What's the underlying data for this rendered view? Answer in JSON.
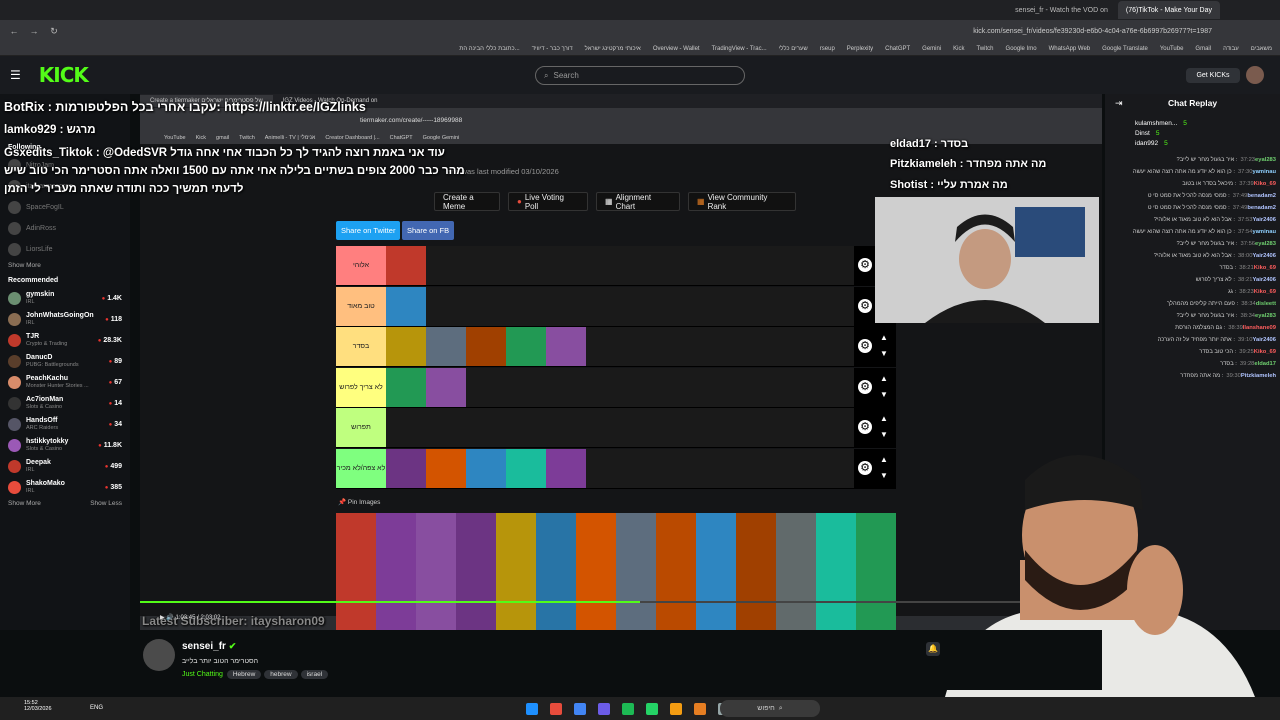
{
  "browser": {
    "tabs": [
      "(76)TikTok - Make Your Day",
      "sensei_fr - Watch the VOD on"
    ],
    "url": "kick.com/sensei_fr/videos/fe39230d-e6b0-4c04-a76e-6b6997b26977?t=1987",
    "bookmarks": [
      "משאבים",
      "עבודה",
      "Gmail",
      "YouTube",
      "Google Translate",
      "WhatsApp Web",
      "Google Imo",
      "Twitch",
      "Kick",
      "Gemini",
      "ChatGPT",
      "Perplexity",
      "rseup",
      "שערים כללי",
      "TradingView - Trac...",
      "Overview - Wallet",
      "איכותי מרקטינג ישראל",
      "דורך כבר - דיוויד",
      "כתובת כללי הבינה הת..."
    ]
  },
  "kick": {
    "logo": "KICK",
    "search_placeholder": "Search",
    "get_kicks": "Get KICKs"
  },
  "sidebar": {
    "following_label": "Following",
    "following": [
      "NitroJam",
      "itamarorzagron",
      "SpaceFogIL",
      "AdinRoss",
      "LiorsLife"
    ],
    "show_more": "Show More",
    "recommended_label": "Recommended",
    "recommended": [
      {
        "name": "gymskin",
        "cat": "IRL",
        "viewers": "1.4K",
        "color": "#6b8f71"
      },
      {
        "name": "JohnWhatsGoingOn",
        "cat": "IRL",
        "viewers": "118",
        "color": "#8a6d52"
      },
      {
        "name": "TJR",
        "cat": "Crypto & Trading",
        "viewers": "28.3K",
        "color": "#c0392b"
      },
      {
        "name": "DanucD",
        "cat": "PUBG: Battlegrounds",
        "viewers": "89",
        "color": "#5a3e2b"
      },
      {
        "name": "PeachKachu",
        "cat": "Monster Hunter Stories ...",
        "viewers": "67",
        "color": "#d88c6a"
      },
      {
        "name": "Ac7ionMan",
        "cat": "Slots & Casino",
        "viewers": "14",
        "color": "#333"
      },
      {
        "name": "HandsOff",
        "cat": "ARC Raiders",
        "viewers": "34",
        "color": "#556"
      },
      {
        "name": "hstikkytokky",
        "cat": "Slots & Casino",
        "viewers": "11.8K",
        "color": "#9b59b6"
      },
      {
        "name": "Deepak",
        "cat": "IRL",
        "viewers": "499",
        "color": "#c0392b"
      },
      {
        "name": "ShakoMako",
        "cat": "IRL",
        "viewers": "385",
        "color": "#e74c3c"
      }
    ],
    "show_more2": "Show More",
    "show_less": "Show Less"
  },
  "inner_browser": {
    "tabs": [
      "Create a tiermaker של פסטרימרים ישראלים",
      "IGZ Videos - Watch On-Demand on"
    ],
    "url": "tiermaker.com/create/-----18969988",
    "bookmarks": [
      "YouTube",
      "Kick",
      "gmail",
      "Twitch",
      "Animelli - TV | אנימלי",
      "Creator Dashboard |...",
      "ChatGPT",
      "Google Gemini"
    ]
  },
  "tiermaker": {
    "modified": "and was last modified 03/10/2026",
    "buttons": [
      "Create a Meme",
      "Live Voting Poll",
      "Alignment Chart",
      "View Community Rank"
    ],
    "share": [
      "Share on Twitter",
      "Share on FB"
    ],
    "tiers": [
      {
        "label": "אלוהי",
        "color": "#ff7f7f"
      },
      {
        "label": "טוב מאוד",
        "color": "#ffbf7f"
      },
      {
        "label": "בסדר",
        "color": "#ffdf7f"
      },
      {
        "label": "לא צריך לפרוש",
        "color": "#ffff7f"
      },
      {
        "label": "תפרוש",
        "color": "#bfff7f"
      },
      {
        "label": "לא צפה/לא מכיר",
        "color": "#7fff7f"
      }
    ],
    "pin_label": "Pin Images"
  },
  "overlay": {
    "bot_line": "BotRix : עקבו אחרי בכל הפלטפורמות: https://linktr.ee/IGZlinks",
    "line2": "lamko929 : מרגש",
    "line3": "Gsxedits_Tiktok : @OdedSVR עוד אני באמת רוצה להגיד לך כל הכבוד אחי אחה גודל",
    "line4": "מהר כבר 2000 צופים בשתיים בלילה אחי אתה עם 1500 וואלה אתה הסטרימר הכי טוב שיש",
    "line5": "לדעתי תמשיך ככה ותודה שאתה מעביר לי הזמן",
    "right1": "eldad17 : בסדר",
    "right2": "Pitzkiameleh : מה אתה מפחדר",
    "right3": "Shotist : מה אמרת עליי",
    "latest_sub": "Latest Subscriber: itaysharon09",
    "time": "1:03:45 / 2:03:02"
  },
  "chat": {
    "title": "Chat Replay",
    "top": [
      {
        "name": "kulamshmen...",
        "count": "5"
      },
      {
        "name": "Dinst",
        "count": "5"
      },
      {
        "name": "idan992",
        "count": "5"
      }
    ],
    "messages": [
      {
        "t": "37:23",
        "u": "eyal283",
        "c": "#6fcf6f",
        "m": "איר בגעול מחר יש לייב?"
      },
      {
        "t": "37:30",
        "u": "yaminau",
        "c": "#8fd0ff",
        "m": "כן הוא לא יודע מה אתה רוצה שהוא יעשה"
      },
      {
        "t": "37:39",
        "u": "Kiko_69",
        "c": "#ff5e5e",
        "m": "מיכאל בסדר או בטוב"
      },
      {
        "t": "37:49",
        "u": "benadam2",
        "c": "#b0c4ff",
        "m": "סמסי מנסה להכיל את סמט סי ט"
      },
      {
        "t": "37:49",
        "u": "benadam2",
        "c": "#b0c4ff",
        "m": "סמסי מנסה להכיל את סמט סי ט"
      },
      {
        "t": "37:53",
        "u": "Yair2406",
        "c": "#b0c4ff",
        "m": "אבל הוא לא טוב מאוד או אלוהי?"
      },
      {
        "t": "37:54",
        "u": "yaminau",
        "c": "#8fd0ff",
        "m": "כן הוא לא יודע מה אתה רוצה שהוא יעשה"
      },
      {
        "t": "37:56",
        "u": "eyal283",
        "c": "#6fcf6f",
        "m": "איר בגעול מחר יש לייב?"
      },
      {
        "t": "38:00",
        "u": "Yair2406",
        "c": "#b0c4ff",
        "m": "אבל הוא לא טוב מאוד או אלוהי?"
      },
      {
        "t": "38:21",
        "u": "Kiko_69",
        "c": "#ff5e5e",
        "m": "בסדר"
      },
      {
        "t": "38:21",
        "u": "Yair2406",
        "c": "#b0c4ff",
        "m": "לא צריך לפרוש"
      },
      {
        "t": "38:23",
        "u": "Kiko_69",
        "c": "#ff5e5e",
        "m": "גג"
      },
      {
        "t": "38:34",
        "u": "disleett",
        "c": "#6fcf6f",
        "m": "פעם הייתה קליפים מהמהלך"
      },
      {
        "t": "38:34",
        "u": "eyal283",
        "c": "#6fcf6f",
        "m": "איר בגעול מחר יש לייב?"
      },
      {
        "t": "38:39",
        "u": "Ilanshane09",
        "c": "#ff5e5e",
        "m": "גם המצלמה הורסת"
      },
      {
        "t": "39:10",
        "u": "Yair2406",
        "c": "#b0c4ff",
        "m": "אתה יותר מפחיד על זה הערכה"
      },
      {
        "t": "39:25",
        "u": "Kiko_69",
        "c": "#ff5e5e",
        "m": "הכי טוב בסדר"
      },
      {
        "t": "39:28",
        "u": "eldad17",
        "c": "#6fcf6f",
        "m": "בסדר"
      },
      {
        "t": "39:30",
        "u": "Pitzkiameleh",
        "c": "#b0c4ff",
        "m": "מה אתה מפחדר"
      }
    ]
  },
  "streamer": {
    "name": "sensei_fr",
    "title": "הסטרימר הטוב יותר בלייב",
    "category": "Just Chatting",
    "tags": [
      "Hebrew",
      "hebrew",
      "israel"
    ]
  },
  "taskbar": {
    "time": "15:52",
    "date": "12/03/2026",
    "lang": "ENG",
    "search": "חיפוש"
  }
}
